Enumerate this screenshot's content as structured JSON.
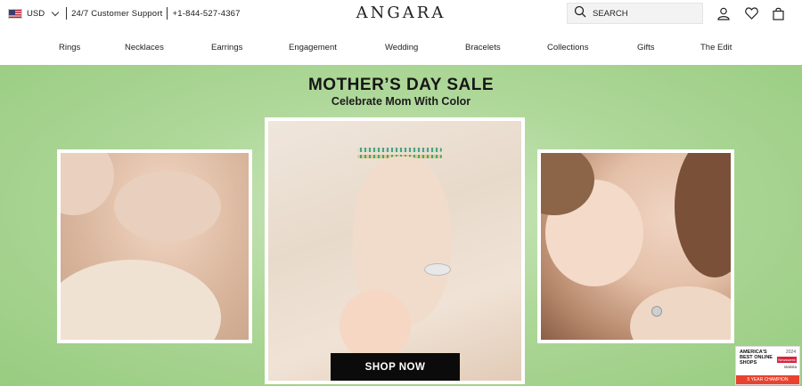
{
  "topbar": {
    "currency": "USD",
    "flag_icon": "us-flag-icon",
    "support_label": "24/7 Customer Support",
    "phone": "+1-844-527-4367",
    "brand": "ANGARA",
    "search_placeholder": "SEARCH"
  },
  "icons": {
    "search": "search-icon",
    "account": "user-icon",
    "wishlist": "heart-icon",
    "cart": "shopping-bag-icon"
  },
  "nav": {
    "items": [
      "Rings",
      "Necklaces",
      "Earrings",
      "Engagement",
      "Wedding",
      "Bracelets",
      "Collections",
      "Gifts",
      "The Edit"
    ]
  },
  "hero": {
    "title": "MOTHER’S DAY SALE",
    "subtitle": "Celebrate Mom With Color",
    "cta": "SHOP NOW",
    "bg_color": "#a8d493"
  },
  "badge": {
    "line1": "AMERICA'S BEST ONLINE SHOPS",
    "year": "2024",
    "publisher": "Newsweek",
    "partner": "statista",
    "footer": "5 YEAR CHAMPION"
  }
}
